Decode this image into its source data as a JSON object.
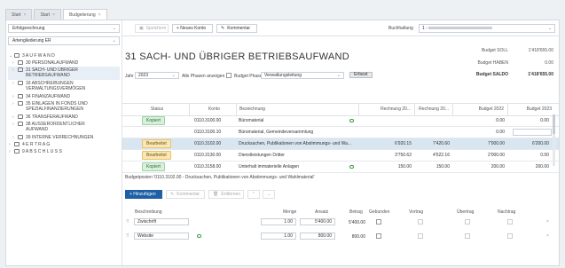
{
  "tabs": [
    {
      "label": "Start"
    },
    {
      "label": "Start"
    },
    {
      "label": "Budgetierung"
    }
  ],
  "sidebar": {
    "dropdown1": "Erfolgsrechnung",
    "dropdown2": "Artengliederung ER",
    "tree": [
      {
        "label": "3 A U F W A N D"
      },
      {
        "label": "30 PERSONALAUFWAND"
      },
      {
        "label": "31 SACH- UND ÜBRIGER"
      },
      {
        "label": "BETRIEBSAUFWAND"
      },
      {
        "label": "33 ABSCHREIBUNGEN"
      },
      {
        "label": "VERWALTUNGSVERMÖGEN"
      },
      {
        "label": "34 FINANZAUFWAND"
      },
      {
        "label": "35 EINLAGEN IN FONDS UND"
      },
      {
        "label": "SPEZIALFINANZIERUNGEN"
      },
      {
        "label": "36 TRANSFERAUFWAND"
      },
      {
        "label": "38 AUSSERORDENTLICHER"
      },
      {
        "label": "AUFWAND"
      },
      {
        "label": "39 INTERNE VERRECHNUNGEN"
      },
      {
        "label": "4 E R T R A G"
      },
      {
        "label": "9 A B S C H L U S S"
      }
    ]
  },
  "toolbar": {
    "save": "Speichern",
    "new_account": "+ Neues Konto",
    "comment": "Kommentar",
    "buchhaltung_label": "Buchhaltung",
    "buchhaltung_value": "1 - "
  },
  "header": {
    "title": "31 SACH- UND ÜBRIGER BETRIEBSAUFWAND",
    "jahr_label": "Jahr",
    "jahr_value": "2023",
    "alle_phasen": "Alle Phasen anzeigen",
    "budget_phase_label": "Budget Phase",
    "budget_phase_value": "Verwaltungsleitung",
    "erfasst": "Erfasst",
    "budget_soll_label": "Budget SOLL",
    "budget_soll_value": "1'418'655.00",
    "budget_haben_label": "Budget HABEN",
    "budget_haben_value": "0.00",
    "budget_saldo_label": "Budget SALDO",
    "budget_saldo_value": "1'418'655.00"
  },
  "grid": {
    "headers": [
      "Status",
      "Konto",
      "Bezeichnung",
      "Rechnung 20...",
      "Rechnung 20...",
      "Budget 2022",
      "Budget 2023"
    ],
    "rows": [
      {
        "status": "Kopiert",
        "konto": "0110.3100.00",
        "bez": "Büromaterial",
        "r1": "",
        "r2": "",
        "b22": "0.00",
        "b23": "0.00",
        "comment": true
      },
      {
        "status": "",
        "konto": "0110.3100.10",
        "bez": "Büromaterial, Gemeindeversammlung",
        "r1": "",
        "r2": "",
        "b22": "0.00",
        "b23": "",
        "comment": false
      },
      {
        "status": "Bearbeitet",
        "konto": "0110.3102.00",
        "bez": "Drucksachen, Publikationen von Abstimmungs- und Wa...",
        "r1": "6'920.15",
        "r2": "7'420.60",
        "b22": "7'000.00",
        "b23": "6'200.00",
        "comment": false
      },
      {
        "status": "Bearbeitet",
        "konto": "0110.3130.00",
        "bez": "Dienstleistungen Dritter",
        "r1": "3'750.62",
        "r2": "4'522.16",
        "b22": "2'000.00",
        "b23": "0.00",
        "comment": false
      },
      {
        "status": "Kopiert",
        "konto": "0110.3158.00",
        "bez": "Unterhalt immaterielle Anlagen",
        "r1": "150.00",
        "r2": "150.00",
        "b22": "200.00",
        "b23": "200.00",
        "comment": true
      }
    ]
  },
  "budgetposten": {
    "title": "Budgetposten '0110.3102.00 - Drucksachen, Publikationen von Abstimmungs- und Wahlmaterial'",
    "add": "+ Hinzufügen",
    "comment": "Kommentar",
    "remove": "Entfernen",
    "headers": [
      "Beschreibung",
      "Menge",
      "Ansatz",
      "Betrag",
      "Gebunden",
      "Vortrag",
      "Übertrag",
      "Nachtrag"
    ],
    "rows": [
      {
        "desc": "Zwischrift",
        "menge": "1.00",
        "ansatz": "5'400.00",
        "betrag": "5'400.00"
      },
      {
        "desc": "Website",
        "menge": "1.00",
        "ansatz": "800.00",
        "betrag": "800.00"
      }
    ]
  }
}
